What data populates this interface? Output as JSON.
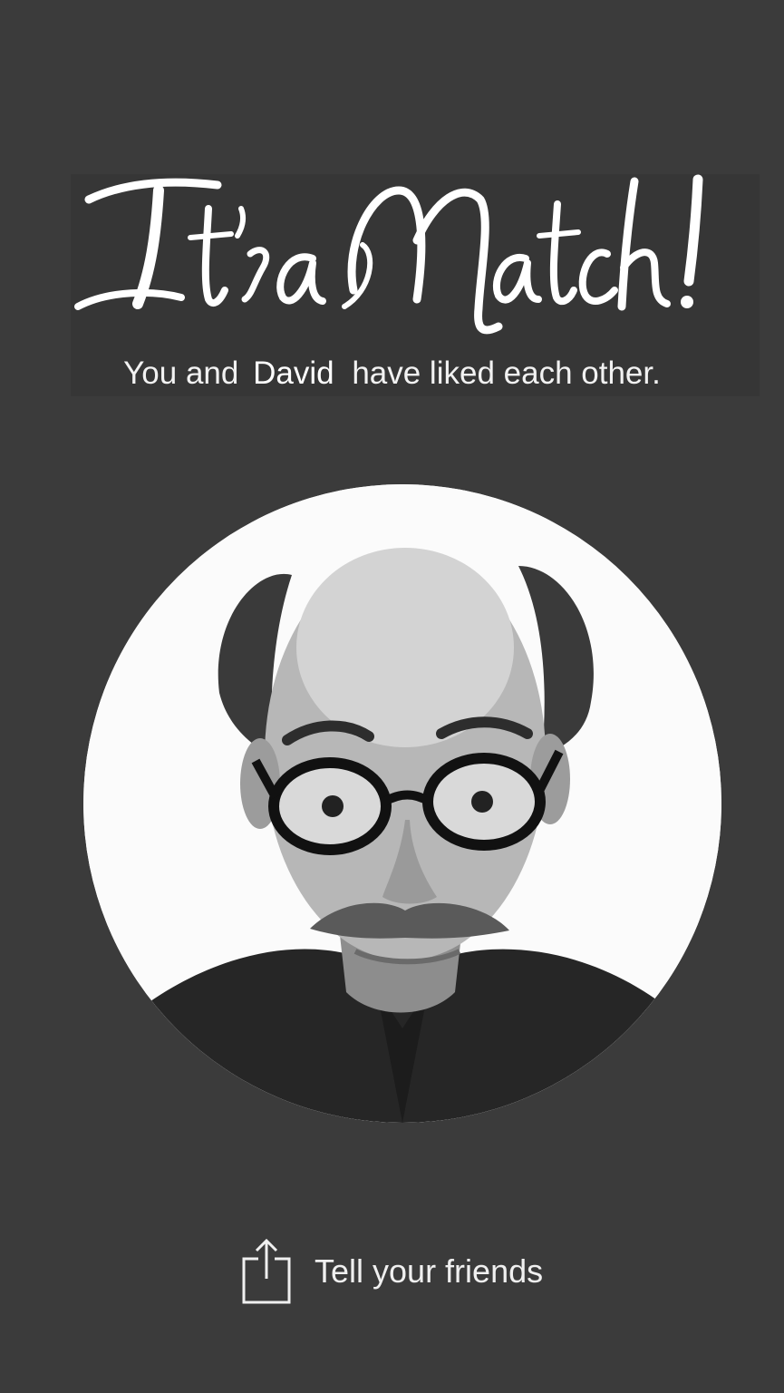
{
  "match": {
    "title": "It's a Match!",
    "subtitle_prefix": "You and",
    "match_name": "David",
    "subtitle_suffix": "have liked each other."
  },
  "profile": {
    "photo_alt": "David"
  },
  "share": {
    "label": "Tell your friends",
    "icon": "share-icon"
  },
  "colors": {
    "background": "#3b3b3b",
    "text": "#f2f2f2",
    "accent": "#ffffff"
  }
}
